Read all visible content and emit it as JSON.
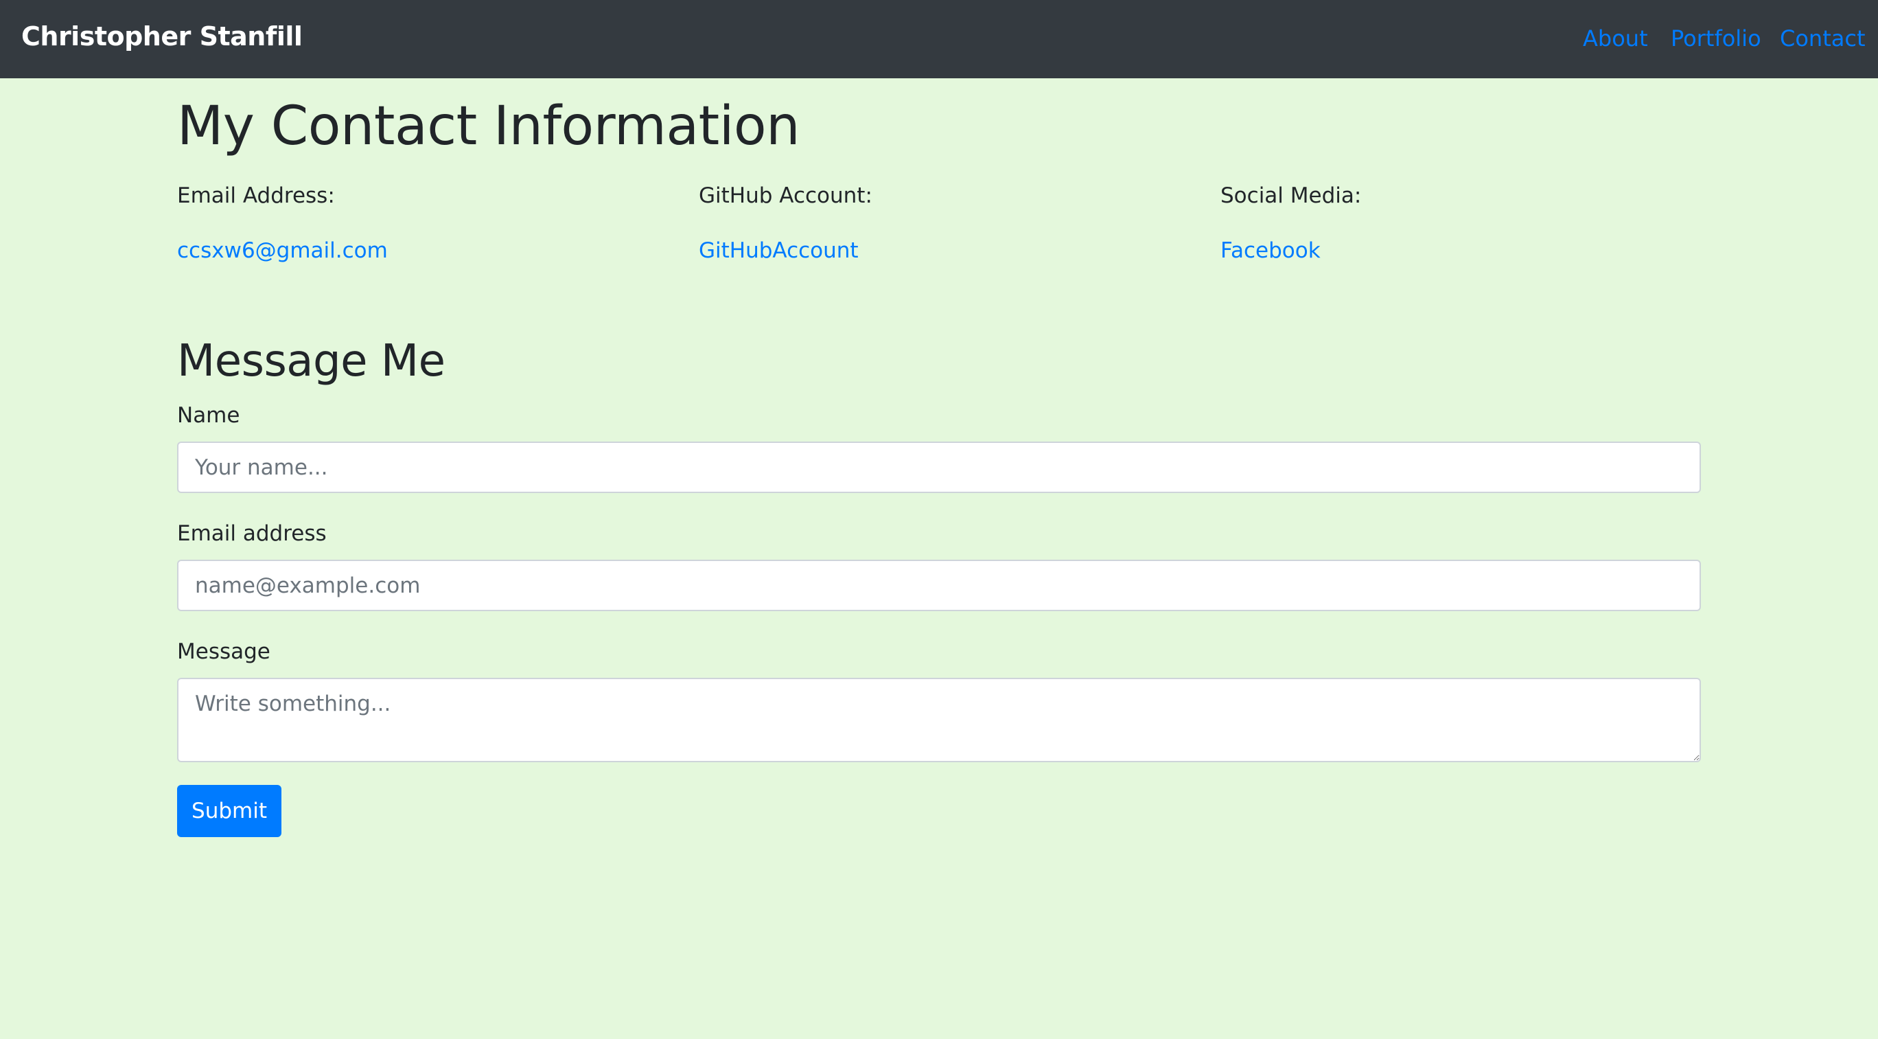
{
  "navbar": {
    "brand": "Christopher Stanfill",
    "links": [
      "About",
      "Portfolio",
      "Contact"
    ],
    "link_color": "#007bff",
    "background": "#343a40"
  },
  "contact": {
    "title": "My Contact Information",
    "columns": [
      {
        "label": "Email Address:",
        "link": "ccsxw6@gmail.com"
      },
      {
        "label": "GitHub Account:",
        "link": "GitHubAccount"
      },
      {
        "label": "Social Media:",
        "link": "Facebook"
      }
    ]
  },
  "form": {
    "title": "Message Me",
    "name_label": "Name",
    "name_placeholder": "Your name...",
    "email_label": "Email address",
    "email_placeholder": "name@example.com",
    "message_label": "Message",
    "message_placeholder": "Write something...",
    "submit_label": "Submit"
  },
  "colors": {
    "page_background": "#e4f8dc",
    "accent": "#007bff"
  }
}
